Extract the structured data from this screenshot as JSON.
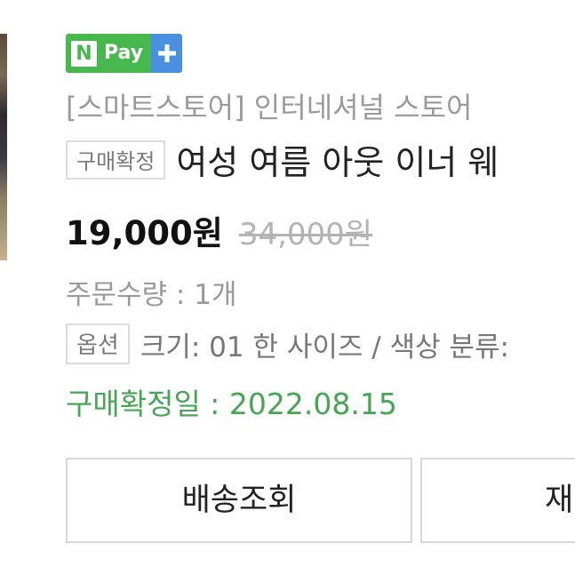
{
  "npay": {
    "n_letter": "N",
    "pay_label": "Pay",
    "colors": {
      "green": "#47b84d",
      "blue": "#4a90e2"
    },
    "plus_icon": "plus-icon"
  },
  "store_name": "[스마트스토어] 인터네셔널 스토어",
  "order": {
    "status_badge": "구매확정",
    "product_title": "여성 여름 아웃 이너 웨",
    "price": "19,000원",
    "original_price": "34,000원",
    "quantity_text": "주문수량 : 1개",
    "option_badge": "옵션",
    "option_text": "크기: 01 한 사이즈 / 색상 분류:",
    "confirm_date": "구매확정일 : 2022.08.15"
  },
  "buttons": {
    "track_delivery": "배송조회",
    "second_partial": "재"
  }
}
